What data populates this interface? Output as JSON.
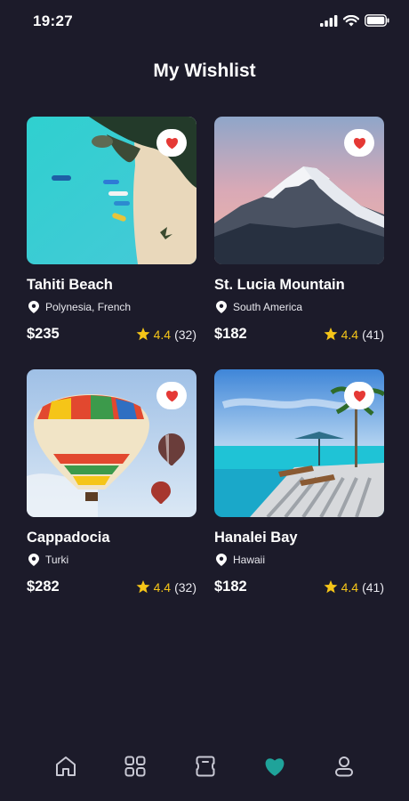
{
  "status_bar": {
    "time": "19:27"
  },
  "header": {
    "title": "My Wishlist"
  },
  "wishlist": [
    {
      "name": "Tahiti Beach",
      "location": "Polynesia, French",
      "price": "$235",
      "rating": "4.4",
      "reviews": "(32)",
      "image": "beach"
    },
    {
      "name": "St. Lucia Mountain",
      "location": "South America",
      "price": "$182",
      "rating": "4.4",
      "reviews": "(41)",
      "image": "mountain"
    },
    {
      "name": "Cappadocia",
      "location": "Turki",
      "price": "$282",
      "rating": "4.4",
      "reviews": "(32)",
      "image": "balloons"
    },
    {
      "name": "Hanalei Bay",
      "location": "Hawaii",
      "price": "$182",
      "rating": "4.4",
      "reviews": "(41)",
      "image": "resort"
    }
  ],
  "bottom_nav": {
    "items": [
      "home-icon",
      "grid-icon",
      "ticket-icon",
      "heart-icon",
      "profile-icon"
    ],
    "active": "heart-icon"
  },
  "colors": {
    "background": "#1c1b2a",
    "accent": "#1fa39a",
    "star": "#f5c518",
    "heart": "#e53935"
  }
}
